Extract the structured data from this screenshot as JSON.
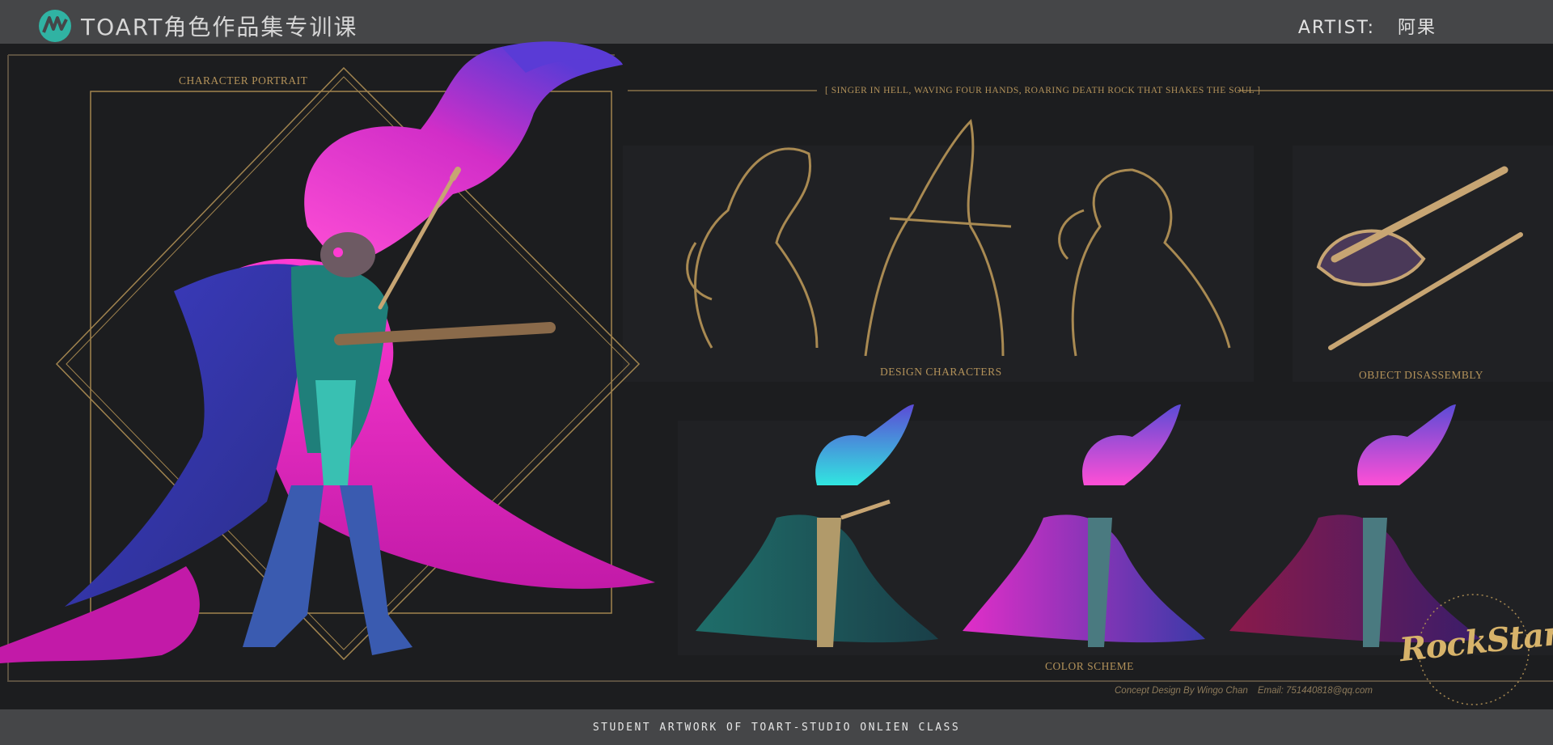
{
  "header": {
    "brand": "TOART角色作品集专训课",
    "artist_label": "ARTIST:",
    "artist_name": "阿果"
  },
  "sections": {
    "portrait_label": "CHARACTER PORTRAIT",
    "tagline": "[  SINGER IN HELL, WAVING FOUR HANDS, ROARING DEATH ROCK THAT SHAKES THE SOUL  ]",
    "design_label": "DESIGN CHARACTERS",
    "object_label": "OBJECT DISASSEMBLY",
    "color_label": "COLOR SCHEME"
  },
  "credit": {
    "designer": "Concept Design By Wingo Chan",
    "email": "Email: 751440818@qq.com"
  },
  "logo_text": "RockStar",
  "footer": "STUDENT ARTWORK OF TOART-STUDIO ONLIEN CLASS",
  "colors": {
    "gold": "#b3925a",
    "magenta": "#e82bd0",
    "violet": "#4a3dc0",
    "teal": "#2fc0b0",
    "cyan": "#31e6e0"
  }
}
